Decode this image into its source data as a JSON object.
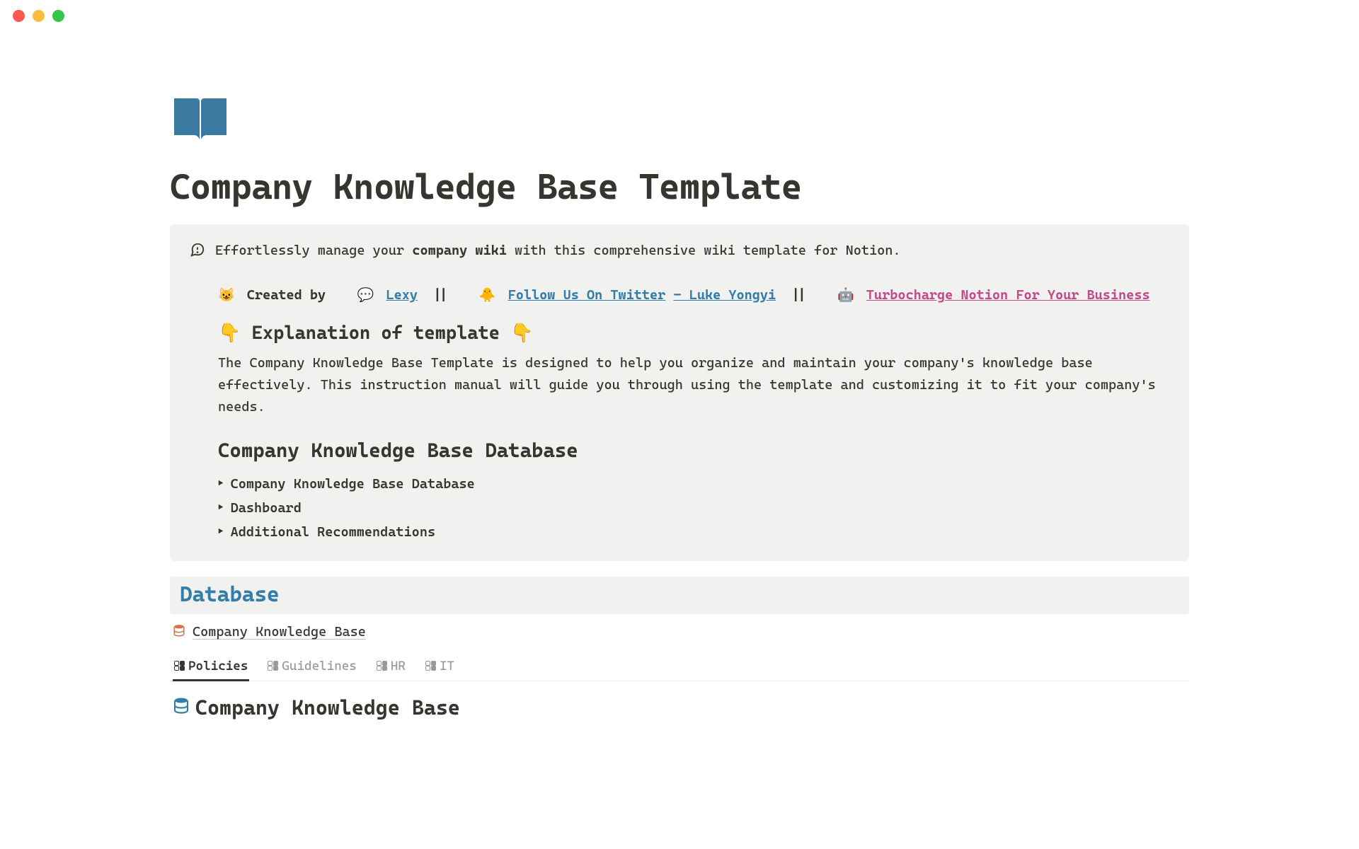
{
  "page": {
    "title": "Company Knowledge Base Template"
  },
  "callout": {
    "intro_prefix": "Effortlessly manage your ",
    "intro_bold": "company wiki",
    "intro_suffix": " with this comprehensive wiki template for Notion.",
    "credit": {
      "emoji1": "😺",
      "created_by": "Created by",
      "emoji2": "💬",
      "lexy": "Lexy",
      "sep": "||",
      "emoji3": "🐥",
      "twitter": "Follow Us On Twitter",
      "dash": " - ",
      "luke": "Luke Yongyi",
      "emoji4": "🤖",
      "turbo": "Turbocharge Notion For Your Business"
    },
    "explanation": {
      "title_prefix": "👇 ",
      "title_text": "Explanation of template",
      "title_suffix": " 👇",
      "body": "The Company Knowledge Base Template is designed to help you organize and maintain your company's knowledge base effectively. This instruction manual will guide you through using the template and customizing it to fit your company's needs."
    },
    "db_section": {
      "heading": "Company Knowledge Base Database",
      "toggles": [
        "Company Knowledge Base Database",
        "Dashboard",
        "Additional Recommendations"
      ]
    }
  },
  "database": {
    "section_heading": "Database",
    "link_label": "Company Knowledge Base",
    "tabs": [
      {
        "label": "Policies",
        "active": true
      },
      {
        "label": "Guidelines",
        "active": false
      },
      {
        "label": "HR",
        "active": false
      },
      {
        "label": "IT",
        "active": false
      }
    ],
    "title": "Company Knowledge Base"
  }
}
